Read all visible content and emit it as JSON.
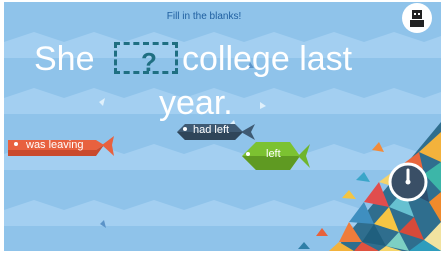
{
  "instruction": "Fill in the blanks!",
  "sentence": {
    "before": "She",
    "blank": "?",
    "after_line1": "college last",
    "after_line2": "year."
  },
  "options": [
    {
      "label": "was leaving",
      "color": "#e8613f"
    },
    {
      "label": "had left",
      "color": "#3f5a73"
    },
    {
      "label": "left",
      "color": "#6fb52c"
    }
  ],
  "colors": {
    "background": "#8fc3ea",
    "wave": "#a7d2f2",
    "sentence_text": "#ffffff",
    "blank_border": "#1f6f82"
  },
  "icons": {
    "profile": "avatar-icon",
    "timer": "timer-icon"
  }
}
